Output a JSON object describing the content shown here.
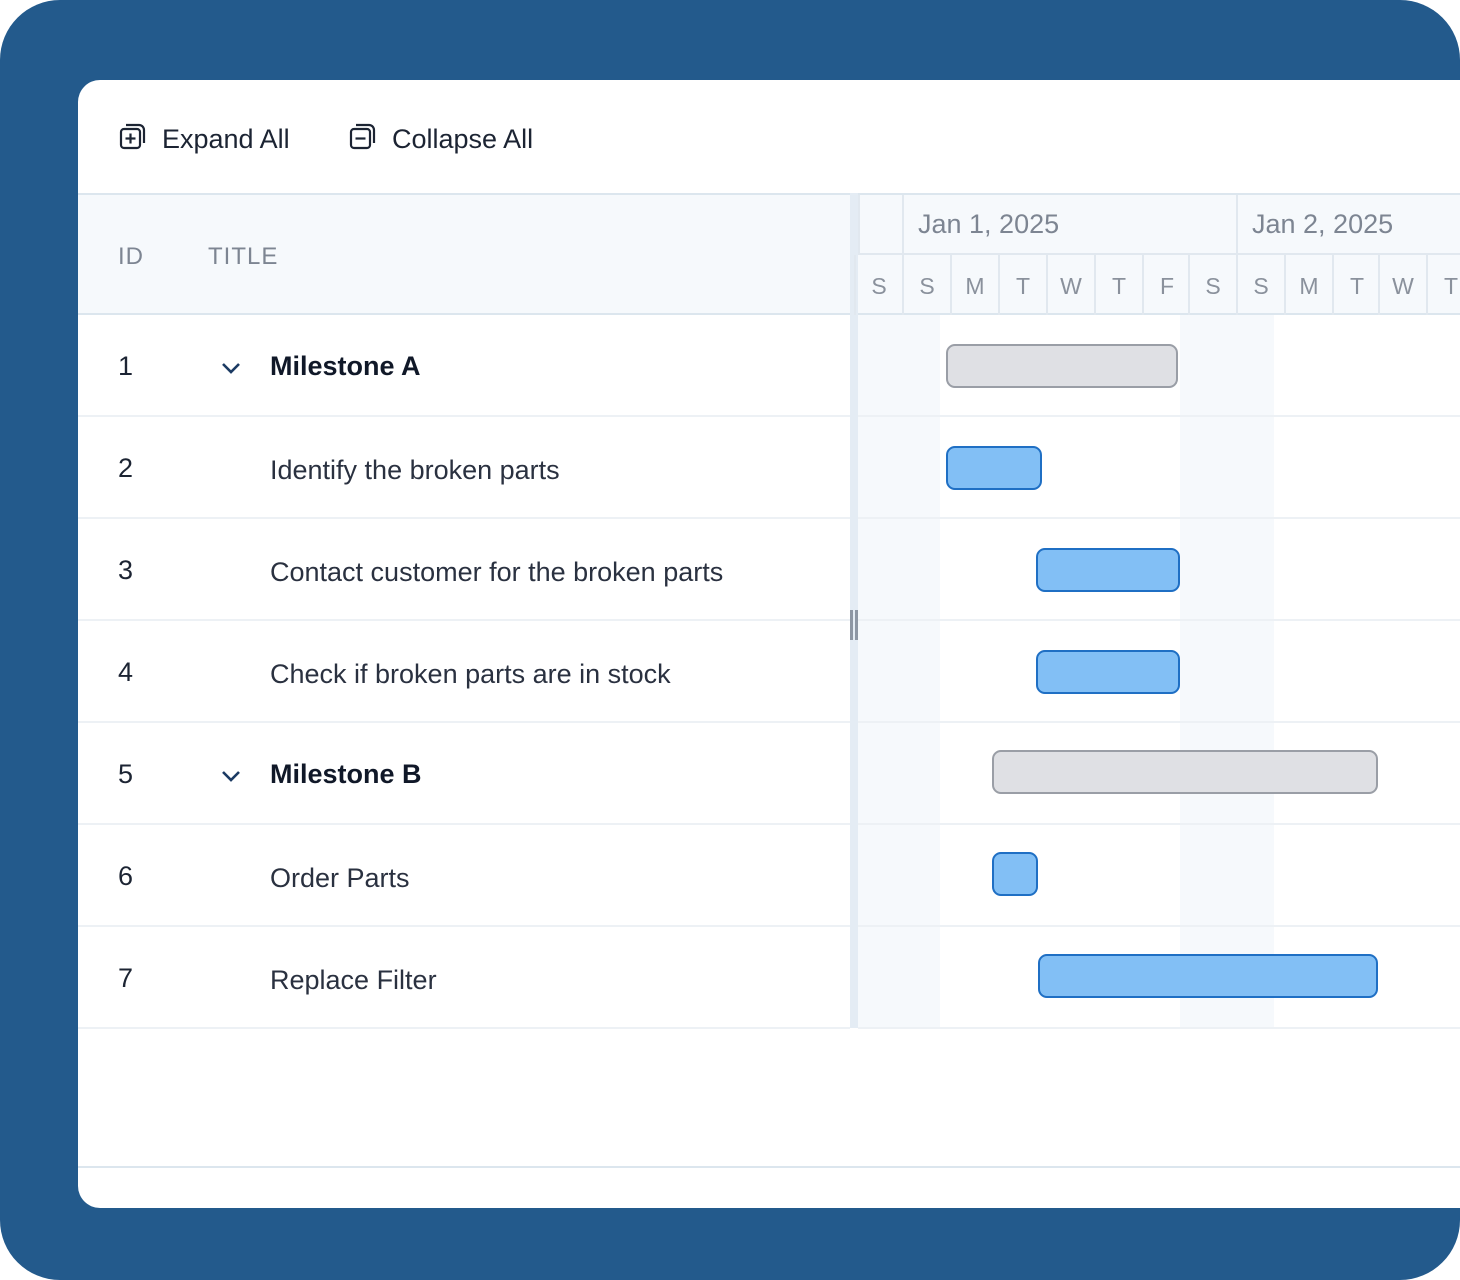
{
  "toolbar": {
    "expand_all": "Expand All",
    "collapse_all": "Collapse All"
  },
  "grid": {
    "columns": {
      "id": "ID",
      "title": "TITLE"
    },
    "rows": [
      {
        "id": "1",
        "title": "Milestone A",
        "parent": true,
        "expanded": true
      },
      {
        "id": "2",
        "title": "Identify the broken parts",
        "parent": false
      },
      {
        "id": "3",
        "title": "Contact customer for the broken parts",
        "parent": false
      },
      {
        "id": "4",
        "title": "Check if broken parts are in stock",
        "parent": false
      },
      {
        "id": "5",
        "title": "Milestone B",
        "parent": true,
        "expanded": true
      },
      {
        "id": "6",
        "title": "Order Parts",
        "parent": false
      },
      {
        "id": "7",
        "title": "Replace Filter",
        "parent": false
      }
    ]
  },
  "timeline": {
    "dates": [
      "Jan 1, 2025",
      "Jan 2, 2025"
    ],
    "days": [
      "S",
      "S",
      "M",
      "T",
      "W",
      "T",
      "F",
      "S",
      "S",
      "M",
      "T",
      "W",
      "T"
    ]
  },
  "colors": {
    "frame": "#235a8c",
    "task_fill": "#82bff5",
    "task_border": "#1f6fc4",
    "summary_fill": "#dfe0e4",
    "summary_border": "#9a9ea6"
  }
}
